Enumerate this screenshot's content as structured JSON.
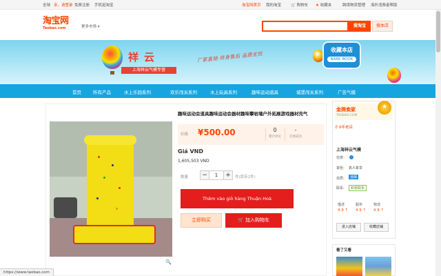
{
  "topbar": {
    "region": "全球",
    "greeting": "亲，请登录",
    "register": "免费注册",
    "mobile": "手机逛淘宝",
    "home": "淘宝网首页",
    "my_taobao": "我的淘宝",
    "cart": "购物车",
    "favorites": "收藏夹",
    "logistics": "跨境物流管理",
    "overseas": "海外消费者帮助"
  },
  "header": {
    "logo_main": "淘宝网",
    "logo_sub": "Taobao.com",
    "more_market": "更多市场",
    "search_taobao": "搜淘宝",
    "search_shop": "搜本店"
  },
  "banner": {
    "brand": "祥云",
    "brand_sub": "上海祥云气模专营",
    "slogan": "厂家直销  终身售后  品质无忧",
    "bookmark_cn": "收藏本店",
    "bookmark_en": "BARK BOOK"
  },
  "nav": [
    "首页",
    "所有产品",
    "水上乐园系列",
    "欢乐闯关系列",
    "水上玩具系列",
    "趣味运动道具",
    "城堡闯关系列",
    "广告气模"
  ],
  "product": {
    "title": "趣味运动会道具趣味运动会器材趣味攀岩墙户外拓展游戏器材充气",
    "price_label": "价格",
    "price": "¥500.00",
    "reviews_count": "0",
    "reviews_label": "累计评论",
    "deals_count": "-",
    "deals_label": "交易成功",
    "gia_label": "Giá VND",
    "gia_value": "1,605,503 VND",
    "qty_label": "数量",
    "qty": "1",
    "stock": "件(库存2件)",
    "add_vn": "Thêm vào giỏ hàng Thuận Hoà",
    "buy_now": "立即购买",
    "add_cart": "加入购物车"
  },
  "shop": {
    "gold_title": "金牌卖家",
    "gold_sub": "TAOBAO.COM",
    "years": "8年老店",
    "name": "上海祥云气模",
    "reputation_label": "信誉:",
    "seller_label": "掌柜:",
    "seller": "衣人年华",
    "qualify_label": "资质:",
    "qualify": "消保",
    "contact_label": "联系:",
    "contact": "和我联系",
    "score_labels": [
      "描述",
      "服务",
      "物流"
    ],
    "score_values": [
      "4.9 ↑",
      "4.9 ↑",
      "4.9 ↑"
    ],
    "enter_shop": "进入店铺",
    "fav_shop": "收藏店铺",
    "also_viewed": "看了又看"
  },
  "status": "https://www.taobao.com",
  "colors": {
    "taobao_orange": "#ff4400",
    "nav_blue": "#17a5e0",
    "button_red": "#e41d1d"
  }
}
